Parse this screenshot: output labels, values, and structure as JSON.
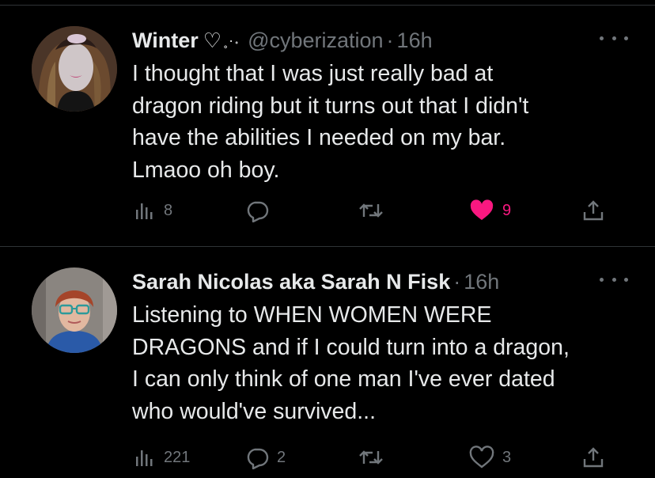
{
  "tweets": [
    {
      "display_name": "Winter",
      "name_decoration": "♡",
      "name_sparkle": "˳·˖",
      "handle": "@cyberization",
      "separator": "·",
      "time": "16h",
      "text_lines": [
        "I thought that I was just really bad at",
        "dragon riding but it turns out that I didn't",
        "have the abilities I needed on my bar.",
        "Lmaoo oh boy."
      ],
      "stats": {
        "views": "8",
        "replies": "",
        "retweets": "",
        "likes": "9",
        "liked": true
      },
      "avatar_icon": "avatar-portrait-woman-long-hair"
    },
    {
      "display_name": "Sarah Nicolas aka Sarah N Fisk",
      "handle": "",
      "separator": "·",
      "time": "16h",
      "text_lines": [
        "Listening to WHEN WOMEN WERE",
        "DRAGONS and if I could turn into a dragon,",
        "I can only think of one man I've ever dated",
        "who would've survived..."
      ],
      "stats": {
        "views": "221",
        "replies": "2",
        "retweets": "",
        "likes": "3",
        "liked": false
      },
      "avatar_icon": "avatar-portrait-woman-glasses"
    }
  ],
  "colors": {
    "background": "#000000",
    "text": "#e7e9ea",
    "muted": "#71767b",
    "like": "#f91880",
    "divider": "#2f3336"
  },
  "icons": [
    "views-icon",
    "reply-icon",
    "retweet-icon",
    "like-icon",
    "share-icon",
    "more-icon"
  ]
}
